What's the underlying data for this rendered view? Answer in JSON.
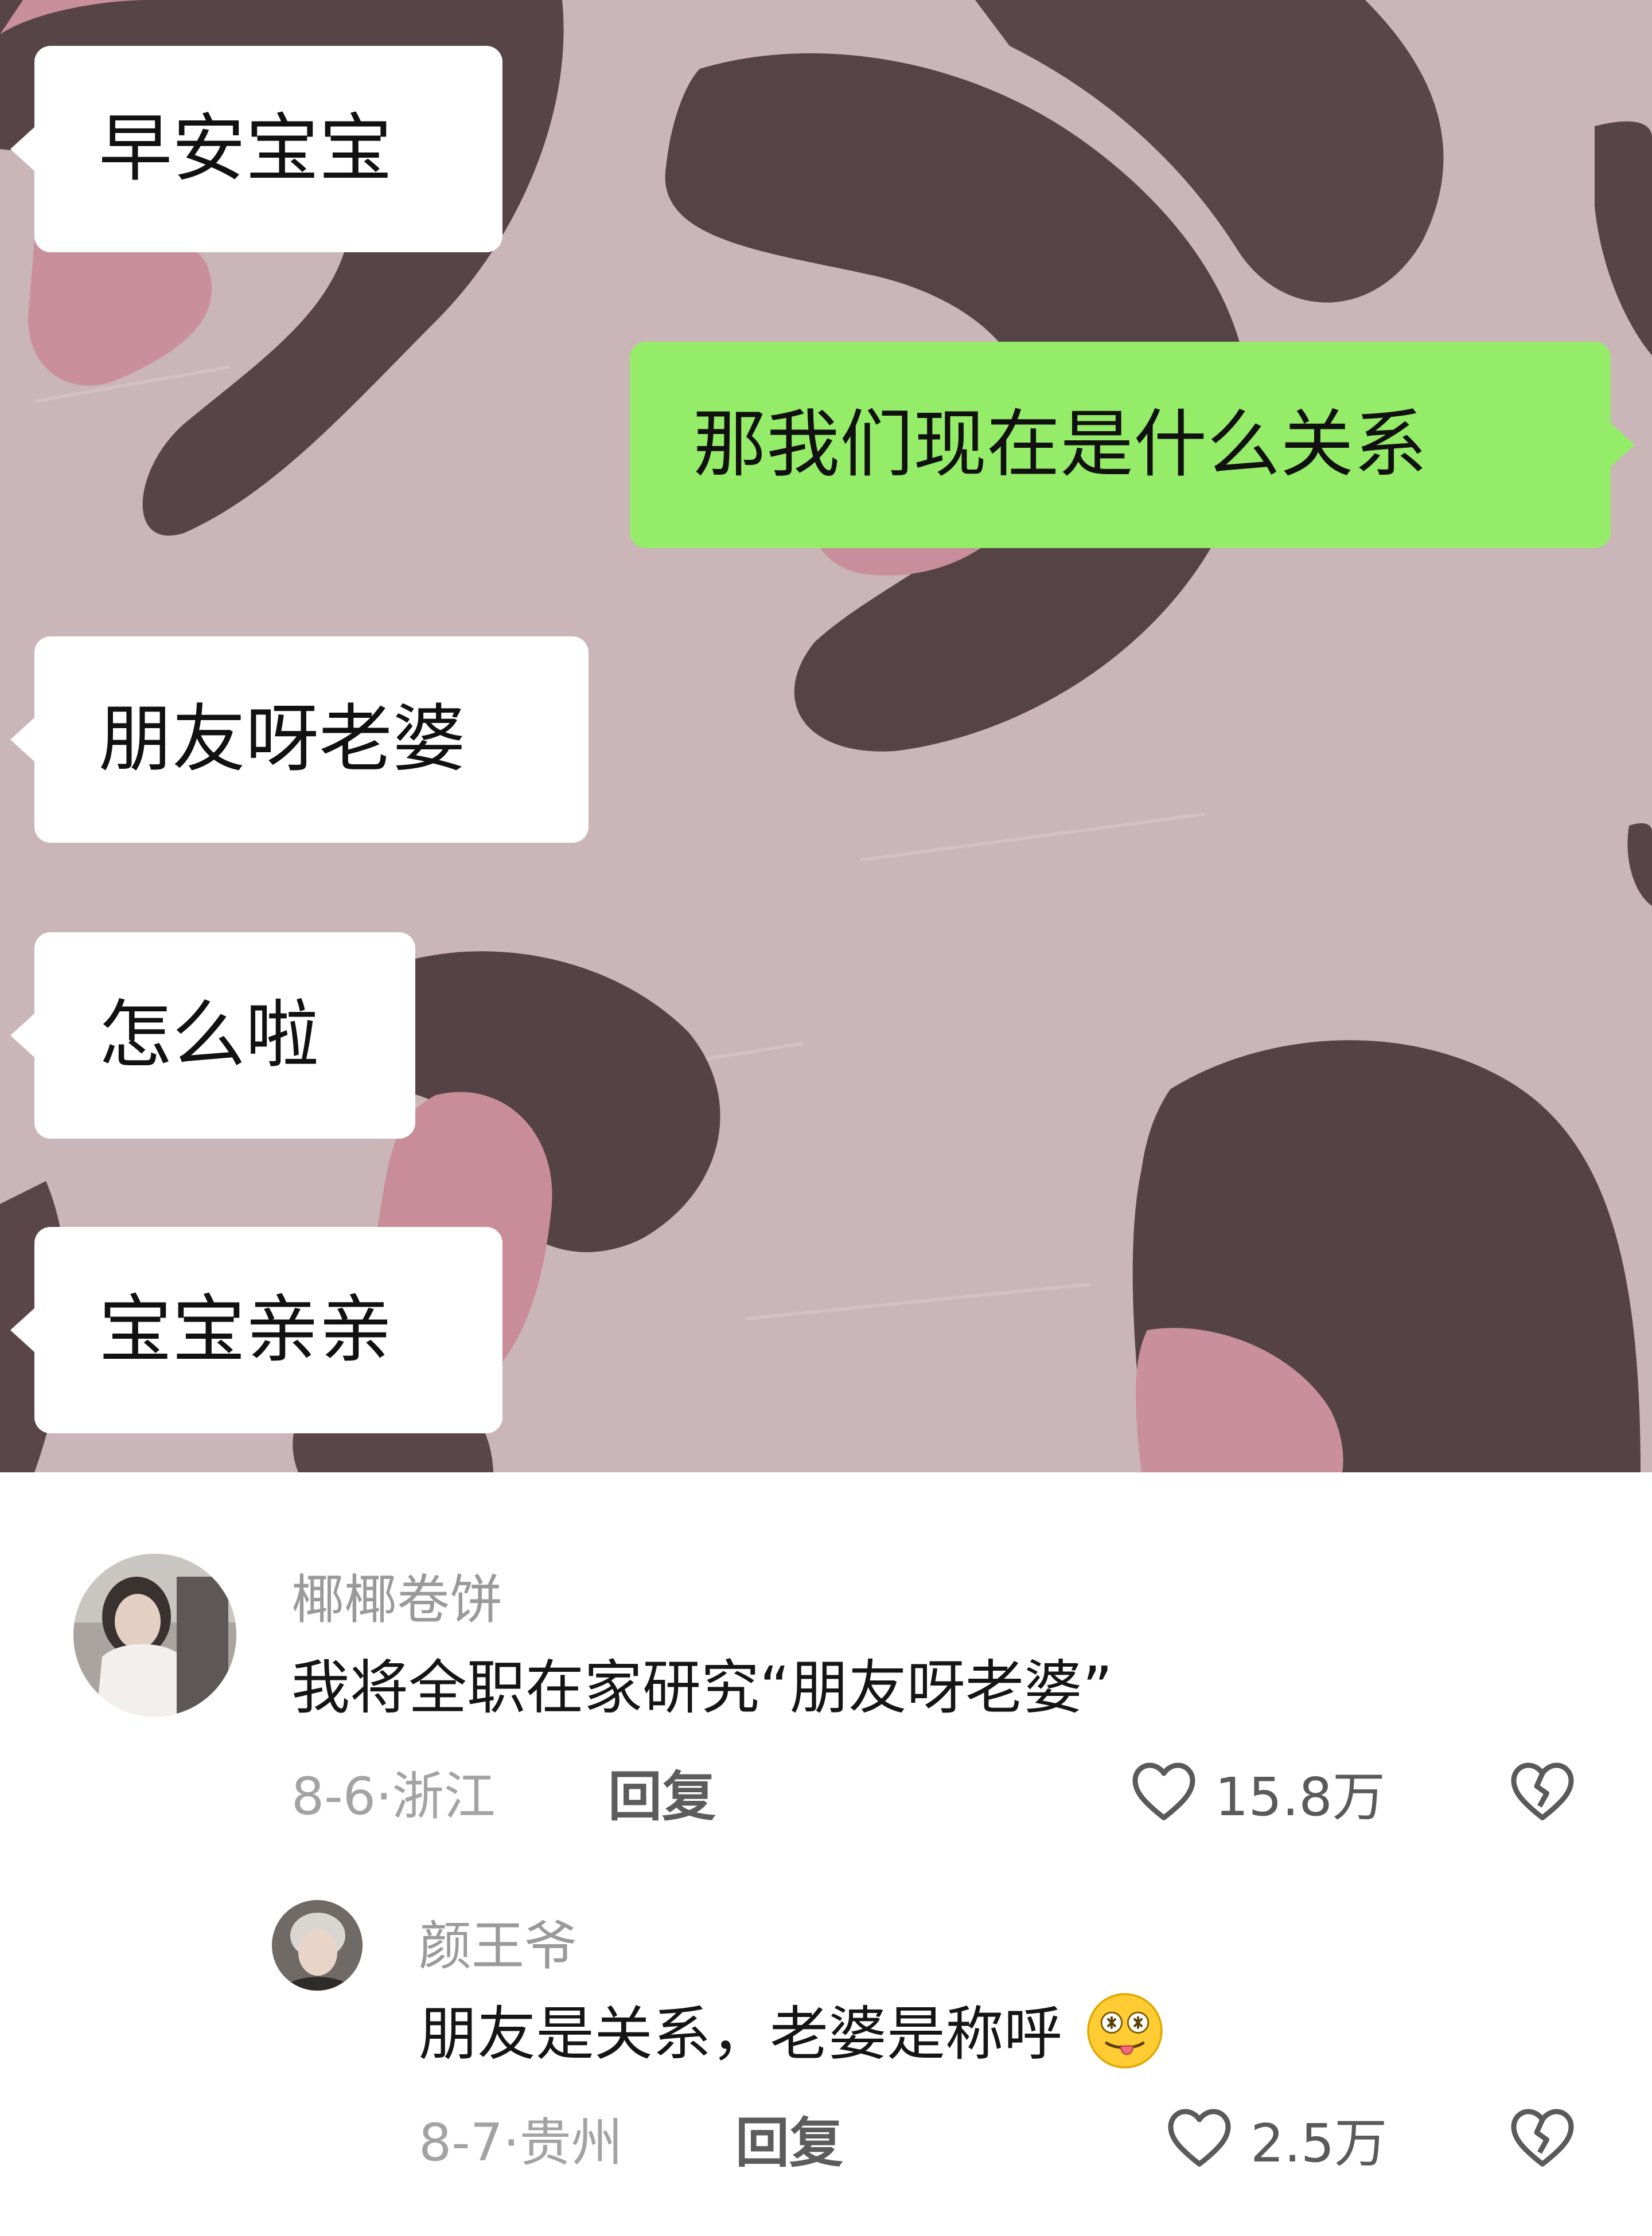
{
  "chat": {
    "messages": [
      {
        "side": "in",
        "text": "早安宝宝"
      },
      {
        "side": "out",
        "text": "那我们现在是什么关系"
      },
      {
        "side": "in",
        "text": "朋友呀老婆"
      },
      {
        "side": "in",
        "text": "怎么啦"
      },
      {
        "side": "in",
        "text": "宝宝亲亲"
      }
    ],
    "bubble_colors": {
      "incoming": "#ffffff",
      "outgoing": "#95ec69"
    }
  },
  "comments": [
    {
      "username": "椰椰卷饼",
      "text": "我将全职在家研究“朋友呀老婆”",
      "date_location": "8-6·浙江",
      "reply_label": "回复",
      "likes": "15.8万",
      "like_icon": "heart-outline-icon",
      "dislike_icon": "broken-heart-icon"
    },
    {
      "username": "颜王爷",
      "text": "朋友是关系，老婆是称呼",
      "emoji": "dizzy-face-tongue-emoji",
      "date_location": "8-7·贵州",
      "reply_label": "回复",
      "likes": "2.5万",
      "like_icon": "heart-outline-icon",
      "dislike_icon": "broken-heart-icon"
    }
  ]
}
